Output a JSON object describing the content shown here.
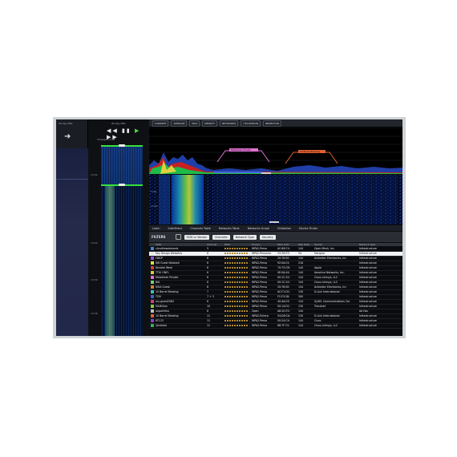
{
  "left_panel": {
    "title": "Wi-Spy DBx"
  },
  "waterfall_panel": {
    "title": "Wi-Spy DBx",
    "controls": [
      "◀◀",
      "▮▮",
      "▶",
      "▶▶"
    ],
    "timespan_label": "Timespan",
    "timespan_value": "1:00",
    "time_labels": [
      "14:02",
      "14:02",
      "13:59",
      "13:58"
    ]
  },
  "toolbar": {
    "items": [
      "CURRENT",
      "AVERAGE",
      "MAX",
      "DENSITY",
      "NETWORKS",
      "UTILIZATION",
      "INSPECTOR"
    ]
  },
  "graph": {
    "channel_labels": [
      "MetaGeek Private",
      "10 Barrel Brewing"
    ]
  },
  "waterfall": {
    "time_label": "Time",
    "time_value": "14:02"
  },
  "tabs": [
    "Learn",
    "Interferers",
    "Channels Table",
    "Networks Table",
    "Networks Graph",
    "Utilization",
    "Device Finder"
  ],
  "filters": {
    "label": "FILTERS",
    "search_placeholder": "SSID or Vendor",
    "dropdowns": [
      "Channels",
      "Network Type",
      "Security"
    ]
  },
  "table": {
    "columns": [
      "",
      "SSID",
      "Channel",
      "RSSI",
      "Privacy",
      "MAC Addr",
      "Max Rate",
      "Vendor",
      "Network Type"
    ],
    "rows": [
      {
        "color": "#3f86d8",
        "ssid": "cloudhawalaxaxis",
        "channel": "5",
        "rssi": "-57",
        "privacy": "WPA2-Perso",
        "mac": "AC:86:74:",
        "rate": "144",
        "vendor": "Open Mesh, Inc.",
        "type": "Infrastructure"
      },
      {
        "color": "#e8e8e8",
        "ssid": "Key Design Websites",
        "channel": "6",
        "rssi": "-55",
        "privacy": "WPA2-Personal",
        "mac": "C0:56:E3:",
        "rate": "54",
        "vendor": "Hangzar",
        "type": "Infrastructure"
      },
      {
        "color": "#9a4ad8",
        "ssid": "OBCP",
        "channel": "6",
        "rssi": "-58",
        "privacy": "WPA2-Perso",
        "mac": "20:76:00:",
        "rate": "144",
        "vendor": "Actiontec Electronics, Inc",
        "type": "Infrastructure"
      },
      {
        "color": "#e0e040",
        "ssid": "KW Guest Network",
        "channel": "6",
        "rssi": "-61",
        "privacy": "WPA2-Perso",
        "mac": "92:0A:01:",
        "rate": "216",
        "vendor": "",
        "type": "Infrastructure"
      },
      {
        "color": "#d04040",
        "ssid": "Kendrel West",
        "channel": "6",
        "rssi": "-62",
        "privacy": "WPA2-Perso",
        "mac": "70:73:CB:",
        "rate": "144",
        "vendor": "Apple",
        "type": "Infrastructure"
      },
      {
        "color": "#d0d040",
        "ssid": "TTHI ONFL",
        "channel": "6",
        "rssi": "-64",
        "privacy": "WPA2-Perso",
        "mac": "0E:0A:44:",
        "rate": "144",
        "vendor": "Aerohive Networks, Inc.",
        "type": "Infrastructure"
      },
      {
        "color": "#e070d0",
        "ssid": "MetaGeek Private",
        "channel": "6",
        "rssi": "-65",
        "privacy": "WPA2-Perso",
        "mac": "00:1C:10:",
        "rate": "144",
        "vendor": "Cisco-Linksys, LLC",
        "type": "Infrastructure"
      },
      {
        "color": "#70d070",
        "ssid": "BIA",
        "channel": "6",
        "rssi": "-67",
        "privacy": "WPA2-Perso",
        "mac": "00:1C:10:",
        "rate": "144",
        "vendor": "Cisco-Linksys, LLC",
        "type": "Infrastructure"
      },
      {
        "color": "#d08030",
        "ssid": "MGA Guest",
        "channel": "6",
        "rssi": "-68",
        "privacy": "WPA2-Perso",
        "mac": "20:76:00:",
        "rate": "144",
        "vendor": "Actiontec Electronics, Inc",
        "type": "Infrastructure"
      },
      {
        "color": "#40c0c0",
        "ssid": "10 Barrel Brewing",
        "channel": "7",
        "rssi": "-68",
        "privacy": "WPA2-Perso",
        "mac": "AC:F1:D1:",
        "rate": "130",
        "vendor": "D-Link International",
        "type": "Infrastructure"
      },
      {
        "color": "#4060d0",
        "ssid": "TCM",
        "channel": "7 + 3",
        "rssi": "-70",
        "privacy": "WPA2-Perso",
        "mac": "FC:F5:28:",
        "rate": "300",
        "vendor": "",
        "type": "Infrastructure"
      },
      {
        "color": "#d04080",
        "ssid": "my-guest2582",
        "channel": "6",
        "rssi": "-71",
        "privacy": "WPA2-Perso",
        "mac": "40:4A:03:",
        "rate": "144",
        "vendor": "ZyXEL Communications Cor",
        "type": "Infrastructure"
      },
      {
        "color": "#80d040",
        "ssid": "MLMillion",
        "channel": "10",
        "rssi": "-72",
        "privacy": "WPA2-Perso",
        "mac": "00:14:D1:",
        "rate": "130",
        "vendor": "Trendnet",
        "type": "Infrastructure"
      },
      {
        "color": "#c0c0c0",
        "ssid": "airportthru",
        "channel": "6",
        "rssi": "-74",
        "privacy": "Open",
        "mac": "A8:2D:F2:",
        "rate": "144",
        "vendor": "",
        "type": "Ad Hoc"
      },
      {
        "color": "#e06030",
        "ssid": "10 Barrel Brewing",
        "channel": "11",
        "rssi": "-75",
        "privacy": "WPA2-Enterp",
        "mac": "54:D6:CA:",
        "rate": "130",
        "vendor": "D-Link International",
        "type": "Infrastructure"
      },
      {
        "color": "#8040d0",
        "ssid": "KT123",
        "channel": "11",
        "rssi": "-78",
        "privacy": "WPA2-Perso",
        "mac": "00:24:C4:",
        "rate": "144",
        "vendor": "Cisco",
        "type": "Infrastructure"
      },
      {
        "color": "#30b060",
        "ssid": "Qinetbot",
        "channel": "11",
        "rssi": "-80",
        "privacy": "WPA2-Perso",
        "mac": "68:7F:74:",
        "rate": "144",
        "vendor": "Cisco-Linksys, LLC",
        "type": "Infrastructure"
      }
    ]
  }
}
